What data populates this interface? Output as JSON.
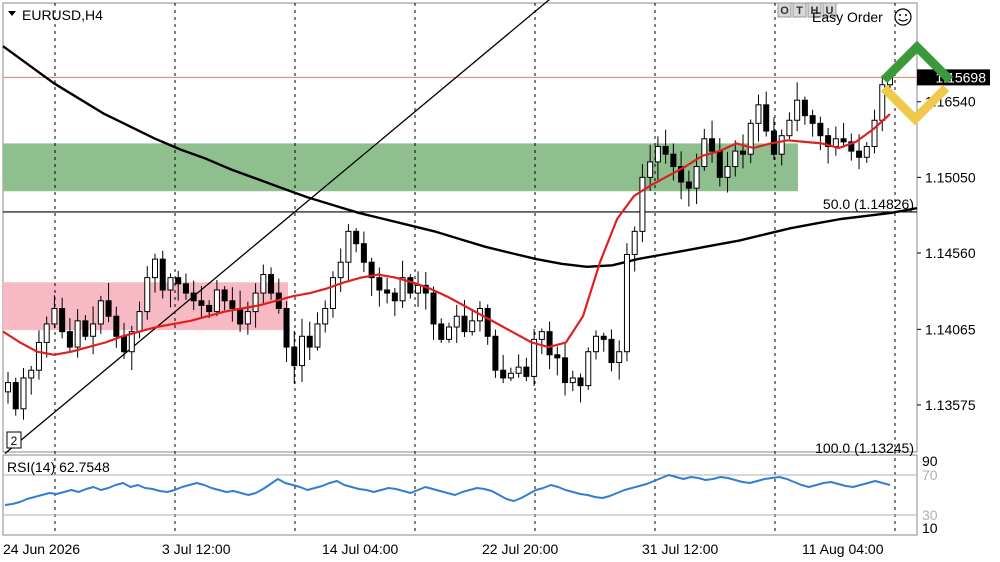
{
  "header": {
    "symbol_label": "EURUSD,H4",
    "menu_icon": "triangle-down-icon",
    "toolbar_letters": [
      "O",
      "T",
      "H",
      "U"
    ],
    "easy_order_label": "Easy Order",
    "smiley_icon": "smiley-icon",
    "logo_icon": "double-chevron-logo"
  },
  "chart_data": {
    "type": "candlestick",
    "symbol": "EURUSD",
    "timeframe": "H4",
    "x_axis": {
      "tick_labels": [
        "24 Jun 2026",
        "3 Jul 12:00",
        "14 Jul 04:00",
        "22 Jul 20:00",
        "31 Jul 12:00",
        "11 Aug 04:00"
      ]
    },
    "y_axis": {
      "tick_labels": [
        "1.16540",
        "1.15050",
        "1.14560",
        "1.14065",
        "1.13575"
      ],
      "tick_values": [
        1.1554,
        1.1505,
        1.1456,
        1.14065,
        1.13575
      ],
      "range": [
        1.1327,
        1.1618
      ]
    },
    "current_price_label": "1.15698",
    "current_price": 1.15698,
    "fibonacci": [
      {
        "label": "50.0 (1.14826)",
        "value": 1.14826
      },
      {
        "label": "100.0 (1.13245)",
        "value": 1.13245
      }
    ],
    "zones": [
      {
        "kind": "resistance",
        "color": "#8fbf8f",
        "price_top": 1.1527,
        "price_bottom": 1.1496
      },
      {
        "kind": "support",
        "color": "#f7b9c3",
        "price_top": 1.1437,
        "price_bottom": 1.1406
      }
    ],
    "close_path": [
      1.1372,
      1.1355,
      1.1375,
      1.138,
      1.1398,
      1.141,
      1.142,
      1.1405,
      1.1395,
      1.1412,
      1.1402,
      1.141,
      1.1425,
      1.1415,
      1.1402,
      1.1392,
      1.1405,
      1.1418,
      1.144,
      1.1452,
      1.1432,
      1.144,
      1.1436,
      1.143,
      1.1425,
      1.1422,
      1.1418,
      1.1432,
      1.1425,
      1.142,
      1.141,
      1.1418,
      1.143,
      1.1442,
      1.143,
      1.142,
      1.1395,
      1.1383,
      1.1402,
      1.1395,
      1.141,
      1.142,
      1.144,
      1.145,
      1.147,
      1.1462,
      1.145,
      1.144,
      1.1432,
      1.143,
      1.1425,
      1.144,
      1.143,
      1.1435,
      1.143,
      1.141,
      1.14,
      1.1408,
      1.1415,
      1.1405,
      1.1412,
      1.142,
      1.1402,
      1.138,
      1.1375,
      1.1378,
      1.1382,
      1.1376,
      1.14,
      1.1405,
      1.139,
      1.1388,
      1.1372,
      1.1375,
      1.137,
      1.1392,
      1.1402,
      1.14,
      1.1385,
      1.1392,
      1.1455,
      1.147,
      1.1505,
      1.1515,
      1.1525,
      1.152,
      1.1512,
      1.1502,
      1.1498,
      1.1512,
      1.153,
      1.1522,
      1.1505,
      1.1512,
      1.1522,
      1.152,
      1.154,
      1.1552,
      1.1535,
      1.152,
      1.1532,
      1.1542,
      1.1555,
      1.1545,
      1.154,
      1.1532,
      1.1525,
      1.153,
      1.1528,
      1.1522,
      1.1518,
      1.1525,
      1.1542,
      1.1565,
      1.157
    ],
    "moving_averages": [
      {
        "name": "MA fast",
        "color": "#e02020",
        "values": [
          1.1405,
          1.1398,
          1.1392,
          1.139,
          1.1392,
          1.1395,
          1.1398,
          1.1402,
          1.1405,
          1.1408,
          1.141,
          1.1412,
          1.1415,
          1.1418,
          1.142,
          1.1422,
          1.1425,
          1.1428,
          1.143,
          1.1433,
          1.1437,
          1.144,
          1.1442,
          1.144,
          1.1437,
          1.1433,
          1.1428,
          1.1422,
          1.1416,
          1.141,
          1.1404,
          1.1398,
          1.1395,
          1.1398,
          1.1415,
          1.145,
          1.1478,
          1.1493,
          1.15,
          1.1506,
          1.1512,
          1.1519,
          1.1522,
          1.1527,
          1.1524,
          1.1527,
          1.1529,
          1.1528,
          1.1527,
          1.1524,
          1.1528,
          1.1536,
          1.1546
        ]
      },
      {
        "name": "MA slow",
        "color": "#000000",
        "values": [
          1.159,
          1.1578,
          1.1566,
          1.1556,
          1.1546,
          1.1538,
          1.153,
          1.1523,
          1.1517,
          1.151,
          1.1504,
          1.1498,
          1.1492,
          1.1487,
          1.1482,
          1.1478,
          1.1474,
          1.147,
          1.1465,
          1.146,
          1.1456,
          1.1452,
          1.1449,
          1.1447,
          1.1448,
          1.1452,
          1.1455,
          1.1458,
          1.1461,
          1.1464,
          1.1468,
          1.1472,
          1.1475,
          1.1478,
          1.148,
          1.1482,
          1.1485
        ]
      }
    ],
    "trendline": {
      "from_price": 1.1326,
      "to_price": 1.17,
      "color": "#000000"
    },
    "indicator": {
      "name_label": "RSI(14) 62.7548",
      "name": "RSI(14)",
      "last_value": 62.7548,
      "levels": [
        70,
        30
      ],
      "level_labels": [
        "70",
        "30"
      ],
      "axis_labels": [
        "90",
        "10"
      ],
      "range": [
        10,
        90
      ],
      "color": "#2f7fd4",
      "values": [
        40,
        41,
        43,
        46,
        48,
        50,
        52,
        51,
        53,
        55,
        53,
        56,
        58,
        55,
        57,
        60,
        62,
        58,
        60,
        57,
        56,
        54,
        53,
        55,
        58,
        60,
        62,
        60,
        57,
        55,
        53,
        54,
        52,
        50,
        52,
        56,
        61,
        66,
        62,
        60,
        58,
        55,
        57,
        59,
        62,
        64,
        60,
        58,
        56,
        55,
        53,
        55,
        57,
        56,
        54,
        52,
        55,
        58,
        56,
        54,
        52,
        50,
        53,
        55,
        57,
        56,
        54,
        50,
        46,
        44,
        47,
        51,
        55,
        57,
        60,
        58,
        55,
        53,
        51,
        50,
        48,
        47,
        49,
        52,
        55,
        57,
        59,
        61,
        64,
        67,
        70,
        68,
        66,
        68,
        67,
        65,
        66,
        68,
        67,
        65,
        63,
        62,
        64,
        66,
        67,
        68,
        66,
        63,
        60,
        58,
        60,
        62,
        63,
        61,
        59,
        58,
        60,
        62,
        64,
        62,
        60
      ]
    }
  }
}
